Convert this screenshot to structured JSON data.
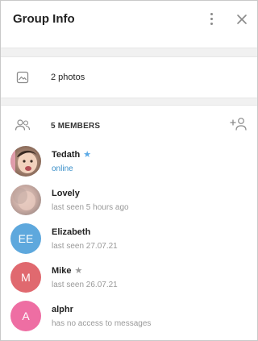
{
  "header": {
    "title": "Group Info"
  },
  "photos": {
    "label": "2 photos"
  },
  "members": {
    "header_label": "5 MEMBERS",
    "list": [
      {
        "name": "Tedath",
        "status": "online",
        "star_color": "#5aa9e6",
        "status_color": "#3a8fc9"
      },
      {
        "name": "Lovely",
        "status": "last seen 5 hours ago"
      },
      {
        "name": "Elizabeth",
        "status": "last seen 27.07.21",
        "initials": "EE",
        "avatar_color": "#5ea8dd"
      },
      {
        "name": "Mike",
        "status": "last seen 26.07.21",
        "initials": "M",
        "avatar_color": "#e0696f",
        "star_color": "#9a9a9a"
      },
      {
        "name": "alphr",
        "status": "has no access to messages",
        "initials": "A",
        "avatar_color": "#ee6ea3"
      }
    ]
  },
  "colors": {
    "accent": "#3a8fc9",
    "icon_gray": "#8a8a8a",
    "separator": "#f1f1f1"
  }
}
